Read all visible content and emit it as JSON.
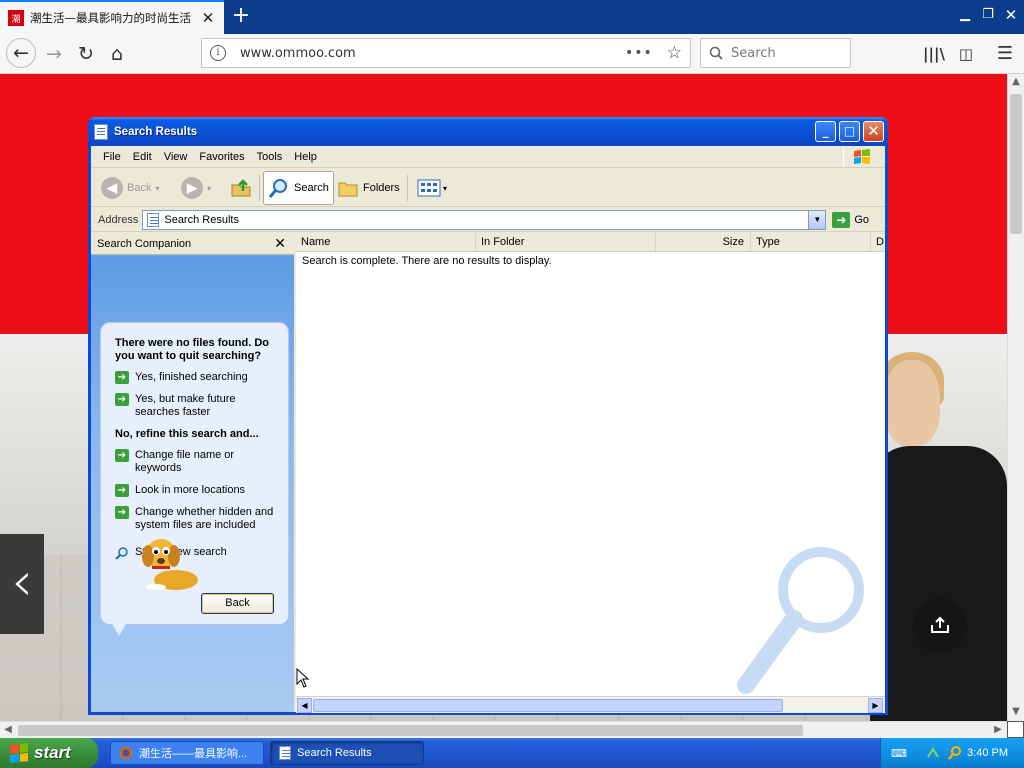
{
  "firefox": {
    "tab_title": "潮生活—最具影响力的时尚生活",
    "tab_favicon_text": "潮",
    "url": "www.ommoo.com",
    "search_placeholder": "Search",
    "accent_color": "#0a84ff",
    "tabbar_color": "#0b3d8a"
  },
  "explorer": {
    "title": "Search Results",
    "menu": [
      "File",
      "Edit",
      "View",
      "Favorites",
      "Tools",
      "Help"
    ],
    "toolbar": {
      "back_label": "Back",
      "search_label": "Search",
      "folders_label": "Folders"
    },
    "address_label": "Address",
    "address_value": "Search Results",
    "go_label": "Go",
    "companion": {
      "header": "Search Companion",
      "prompt": "There were no files found. Do you want to quit searching?",
      "options_quit": [
        "Yes, finished searching",
        "Yes, but make future searches faster"
      ],
      "refine_heading": "No, refine this search and...",
      "options_refine": [
        "Change file name or keywords",
        "Look in more locations",
        "Change whether hidden and system files are included"
      ],
      "new_search": "Start a new search",
      "back_button": "Back"
    },
    "columns": [
      "Name",
      "In Folder",
      "Size",
      "Type",
      "D"
    ],
    "empty_message": "Search is complete. There are no results to display."
  },
  "taskbar": {
    "start_label": "start",
    "tasks": [
      "潮生活——最具影响...",
      "Search Results"
    ],
    "clock": "3:40 PM"
  }
}
